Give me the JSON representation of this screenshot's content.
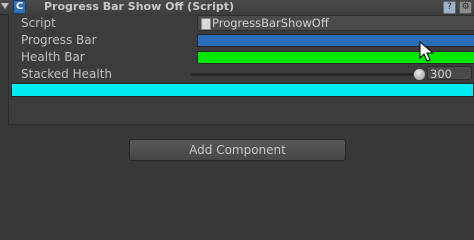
{
  "component": {
    "title": "Progress Bar Show Off (Script)",
    "script_badge": "C",
    "help_glyph": "?",
    "settings_glyph": "⚙"
  },
  "fields": {
    "script_label": "Script",
    "script_value": "ProgressBarShowOff",
    "progress_label": "Progress Bar",
    "progress_fill": 1.0,
    "progress_color": "#2a6db8",
    "health_label": "Health Bar",
    "health_fill": 1.0,
    "health_color": "#00e800",
    "stacked_label": "Stacked Health",
    "stacked_value": "300",
    "stacked_fill": 1.0,
    "stacked_color": "#00eef2"
  },
  "add_component_label": "Add Component",
  "icons": [
    "fold-arrow-icon",
    "script-icon",
    "help-icon",
    "settings-icon",
    "script-file-icon",
    "mouse-cursor-icon"
  ]
}
